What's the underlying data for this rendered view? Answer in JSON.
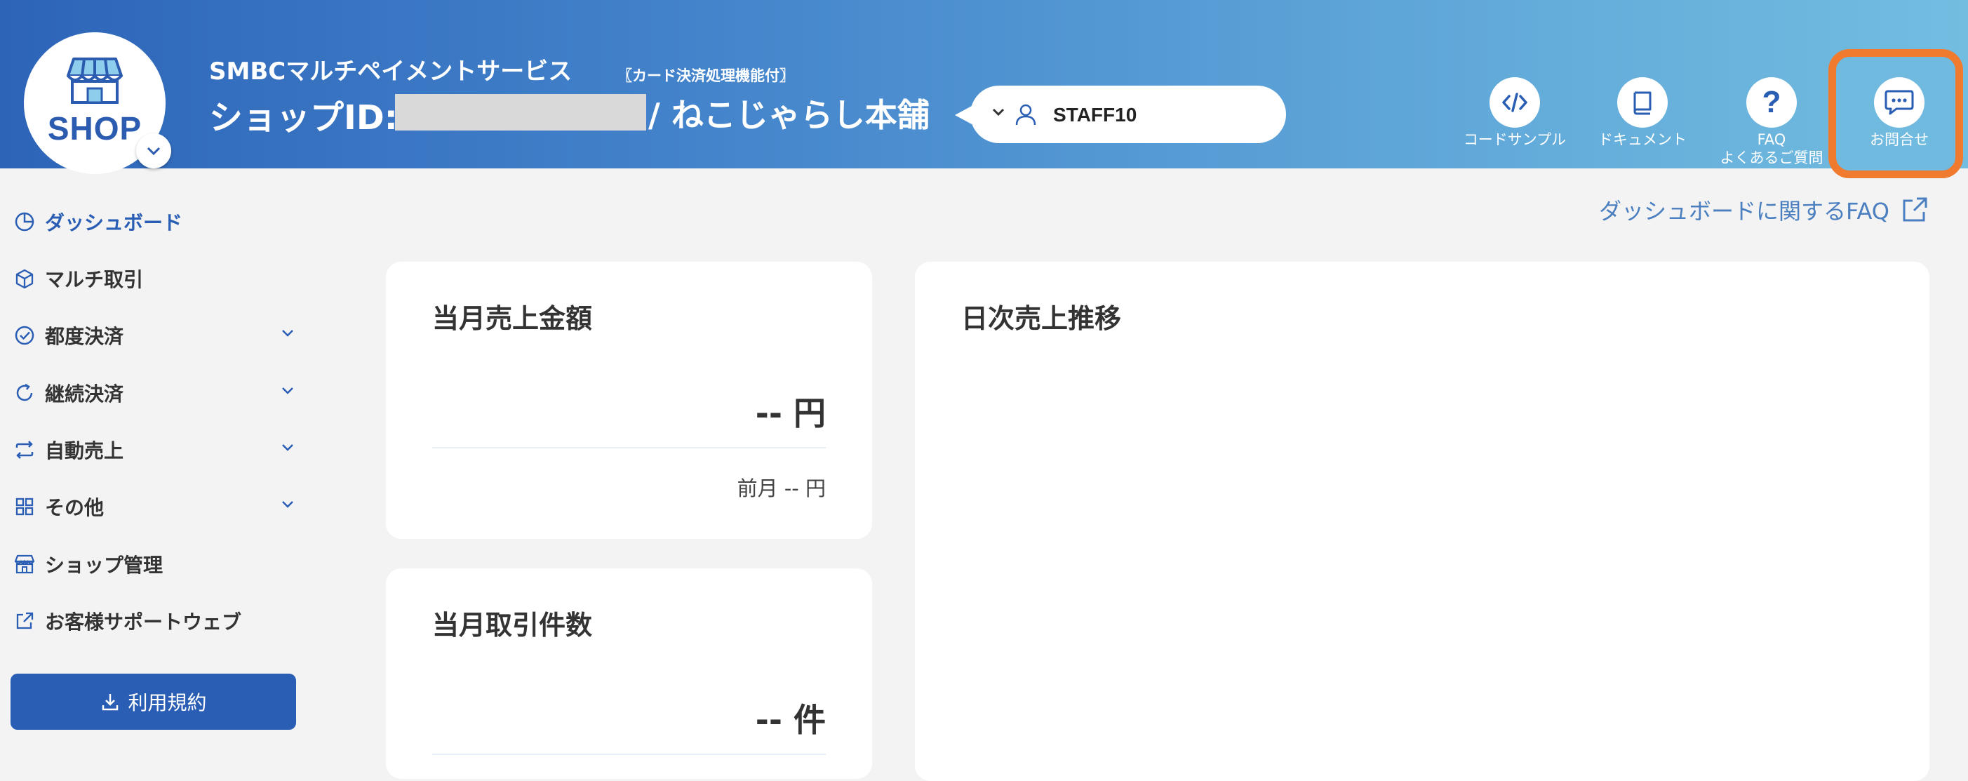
{
  "header": {
    "logo_text": "SHOP",
    "service_name": "SMBCマルチペイメントサービス",
    "service_badge": "〖カード決済処理機能付〗",
    "shop_id_label": "ショップID:",
    "shop_name": "/ ねこじゃらし本舗",
    "staff_name": "STAFF10",
    "buttons": [
      {
        "label": "コードサンプル",
        "icon": "code-icon"
      },
      {
        "label": "ドキュメント",
        "icon": "book-icon"
      },
      {
        "label": "FAQ",
        "label2": "よくあるご質問",
        "icon": "question-icon"
      },
      {
        "label": "お問合せ",
        "icon": "chat-icon"
      }
    ],
    "colors": {
      "gradient_start": "#2d64b8",
      "gradient_end": "#72bde0",
      "highlight": "#f07a2e"
    }
  },
  "sidebar": {
    "items": [
      {
        "label": "ダッシュボード",
        "icon": "clock-pie-icon",
        "active": true
      },
      {
        "label": "マルチ取引",
        "icon": "cube-icon"
      },
      {
        "label": "都度決済",
        "icon": "check-circle-icon",
        "expandable": true
      },
      {
        "label": "継続決済",
        "icon": "refresh-icon",
        "expandable": true
      },
      {
        "label": "自動売上",
        "icon": "swap-icon",
        "expandable": true
      },
      {
        "label": "その他",
        "icon": "grid-icon",
        "expandable": true
      },
      {
        "label": "ショップ管理",
        "icon": "store-icon"
      },
      {
        "label": "お客様サポートウェブ",
        "icon": "external-link-icon"
      }
    ],
    "terms_button": "利用規約",
    "accent": "#2a5eb4"
  },
  "main": {
    "faq_link": "ダッシュボードに関するFAQ",
    "sales_card": {
      "title": "当月売上金額",
      "value": "-- 円",
      "prev": "前月 -- 円"
    },
    "count_card": {
      "title": "当月取引件数",
      "value": "-- 件"
    },
    "daily_card": {
      "title": "日次売上推移"
    }
  }
}
